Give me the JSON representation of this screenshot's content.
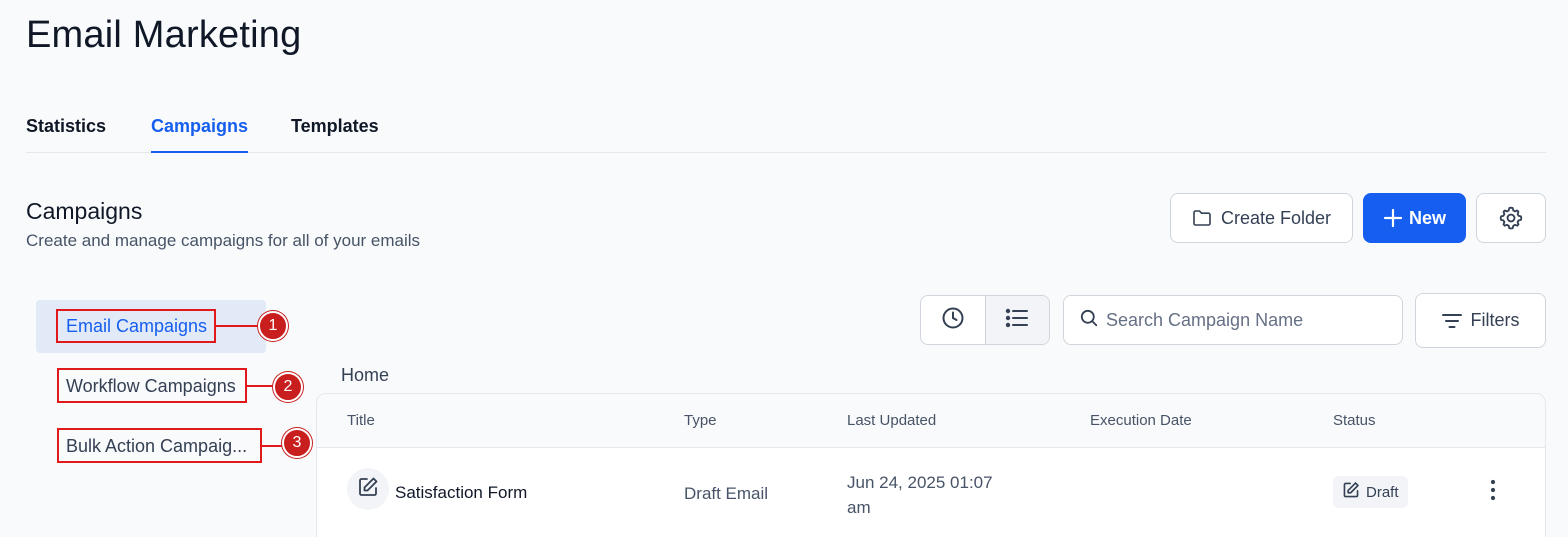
{
  "page": {
    "title": "Email Marketing"
  },
  "tabs": [
    {
      "label": "Statistics"
    },
    {
      "label": "Campaigns"
    },
    {
      "label": "Templates"
    }
  ],
  "section": {
    "title": "Campaigns",
    "subtitle": "Create and manage campaigns for all of your emails"
  },
  "actions": {
    "create_folder": "Create Folder",
    "new": "New",
    "settings_icon": "gear-icon"
  },
  "sidebar": {
    "items": [
      {
        "label": "Email Campaigns",
        "callout": "1"
      },
      {
        "label": "Workflow Campaigns",
        "callout": "2"
      },
      {
        "label": "Bulk Action Campaig...",
        "callout": "3"
      }
    ]
  },
  "toolbar": {
    "search_placeholder": "Search Campaign Name",
    "filters": "Filters"
  },
  "breadcrumb": "Home",
  "table": {
    "columns": [
      "Title",
      "Type",
      "Last Updated",
      "Execution Date",
      "Status"
    ],
    "rows": [
      {
        "title": "Satisfaction Form",
        "type": "Draft Email",
        "last_updated_line1": "Jun 24, 2025 01:07",
        "last_updated_line2": "am",
        "execution_date": "",
        "status": "Draft"
      }
    ]
  },
  "colors": {
    "accent": "#155eef",
    "callout_red": "#e01a1a",
    "active_bg": "#e2eaf8"
  }
}
